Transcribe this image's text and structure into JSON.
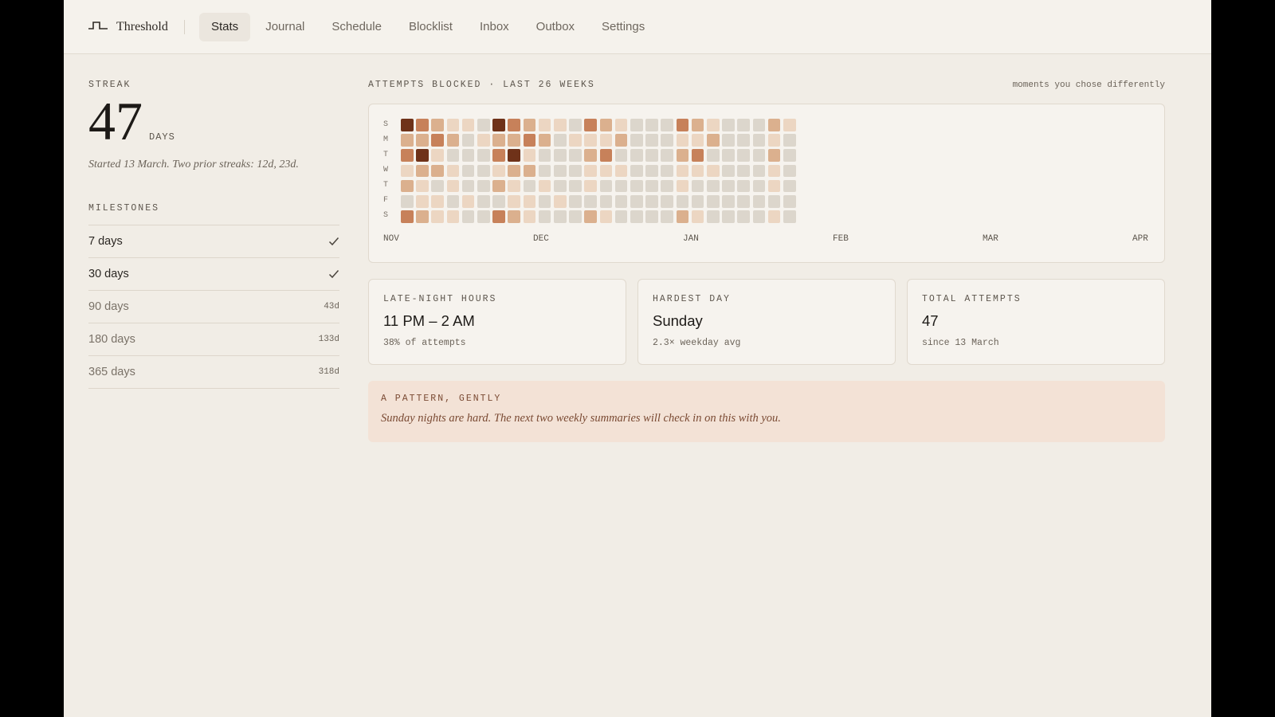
{
  "app": {
    "name": "Threshold"
  },
  "nav": {
    "items": [
      {
        "label": "Stats",
        "active": true
      },
      {
        "label": "Journal"
      },
      {
        "label": "Schedule"
      },
      {
        "label": "Blocklist"
      },
      {
        "label": "Inbox"
      },
      {
        "label": "Outbox"
      },
      {
        "label": "Settings"
      }
    ]
  },
  "streak": {
    "label": "STREAK",
    "value": "47",
    "unit": "DAYS",
    "note": "Started 13 March. Two prior streaks: 12d, 23d."
  },
  "milestones": {
    "title": "MILESTONES",
    "items": [
      {
        "label": "7 days",
        "done": true,
        "meta": ""
      },
      {
        "label": "30 days",
        "done": true,
        "meta": ""
      },
      {
        "label": "90 days",
        "done": false,
        "meta": "43d"
      },
      {
        "label": "180 days",
        "done": false,
        "meta": "133d"
      },
      {
        "label": "365 days",
        "done": false,
        "meta": "318d"
      }
    ]
  },
  "heatmap": {
    "title": "ATTEMPTS BLOCKED · LAST 26 WEEKS",
    "subtitle": "moments you chose differently",
    "row_labels": [
      "S",
      "M",
      "T",
      "W",
      "T",
      "F",
      "S"
    ],
    "months": [
      "NOV",
      "DEC",
      "JAN",
      "FEB",
      "MAR",
      "APR"
    ],
    "colors": [
      "#dcd6cc",
      "#ecd6c2",
      "#dbb08e",
      "#c7815a",
      "#6f3219"
    ]
  },
  "chart_data": {
    "type": "heatmap",
    "title": "ATTEMPTS BLOCKED · LAST 26 WEEKS",
    "subtitle": "moments you chose differently",
    "rows": [
      "S",
      "M",
      "T",
      "W",
      "T",
      "F",
      "S"
    ],
    "x_tick_labels": [
      "NOV",
      "DEC",
      "JAN",
      "FEB",
      "MAR",
      "APR"
    ],
    "weeks_shown": 26,
    "legend": "none",
    "intensity_levels": [
      0,
      1,
      2,
      3,
      4
    ],
    "values": [
      [
        4,
        3,
        2,
        1,
        1,
        0,
        4,
        3,
        2,
        1,
        1,
        0,
        3,
        2,
        1,
        0,
        0,
        0,
        3,
        2,
        1,
        0,
        0,
        0,
        2,
        1
      ],
      [
        2,
        2,
        3,
        2,
        0,
        1,
        2,
        2,
        3,
        2,
        0,
        1,
        1,
        1,
        2,
        0,
        0,
        0,
        1,
        1,
        2,
        0,
        0,
        0,
        1,
        0
      ],
      [
        3,
        4,
        1,
        0,
        0,
        0,
        3,
        4,
        1,
        0,
        0,
        0,
        2,
        3,
        0,
        0,
        0,
        0,
        2,
        3,
        0,
        0,
        0,
        0,
        2,
        0
      ],
      [
        1,
        2,
        2,
        1,
        0,
        0,
        1,
        2,
        2,
        0,
        0,
        0,
        1,
        1,
        1,
        0,
        0,
        0,
        1,
        1,
        1,
        0,
        0,
        0,
        1,
        0
      ],
      [
        2,
        1,
        0,
        1,
        0,
        0,
        2,
        1,
        0,
        1,
        0,
        0,
        1,
        0,
        0,
        0,
        0,
        0,
        1,
        0,
        0,
        0,
        0,
        0,
        1,
        0
      ],
      [
        0,
        1,
        1,
        0,
        1,
        0,
        0,
        1,
        1,
        0,
        1,
        0,
        0,
        0,
        0,
        0,
        0,
        0,
        0,
        0,
        0,
        0,
        0,
        0,
        0,
        0
      ],
      [
        3,
        2,
        1,
        1,
        0,
        0,
        3,
        2,
        1,
        0,
        0,
        0,
        2,
        1,
        0,
        0,
        0,
        0,
        2,
        1,
        0,
        0,
        0,
        0,
        1,
        0
      ]
    ]
  },
  "stats": [
    {
      "label": "LATE-NIGHT HOURS",
      "value": "11 PM – 2 AM",
      "sub": "38% of attempts"
    },
    {
      "label": "HARDEST DAY",
      "value": "Sunday",
      "sub": "2.3× weekday avg"
    },
    {
      "label": "TOTAL ATTEMPTS",
      "value": "47",
      "sub": "since 13 March"
    }
  ],
  "pattern": {
    "title": "A PATTERN, GENTLY",
    "text": "Sunday nights are hard. The next two weekly summaries will check in on this with you."
  }
}
